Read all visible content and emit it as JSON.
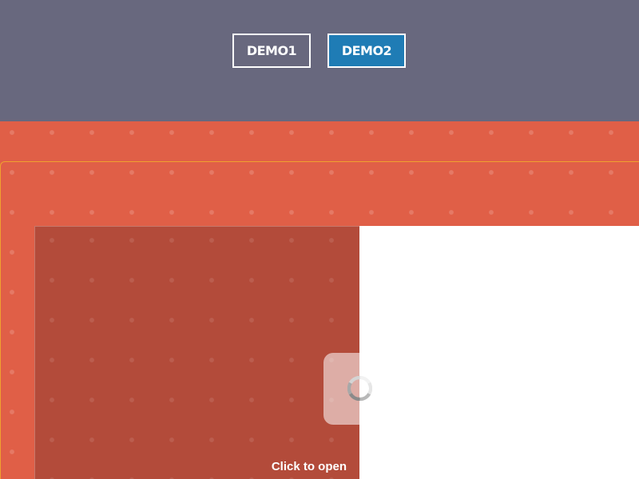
{
  "header": {
    "buttons": [
      {
        "label": "DEMO1",
        "selected": false
      },
      {
        "label": "DEMO2",
        "selected": true
      }
    ]
  },
  "book": {
    "open_hint": "Click to open",
    "loading_icon": "spinner-icon"
  },
  "colors": {
    "header_bg": "#68687e",
    "stage_bg": "#e05f47",
    "panel_bg": "#b34b3a",
    "active_button": "#1f7cb5",
    "frame_border": "#f0a030"
  }
}
